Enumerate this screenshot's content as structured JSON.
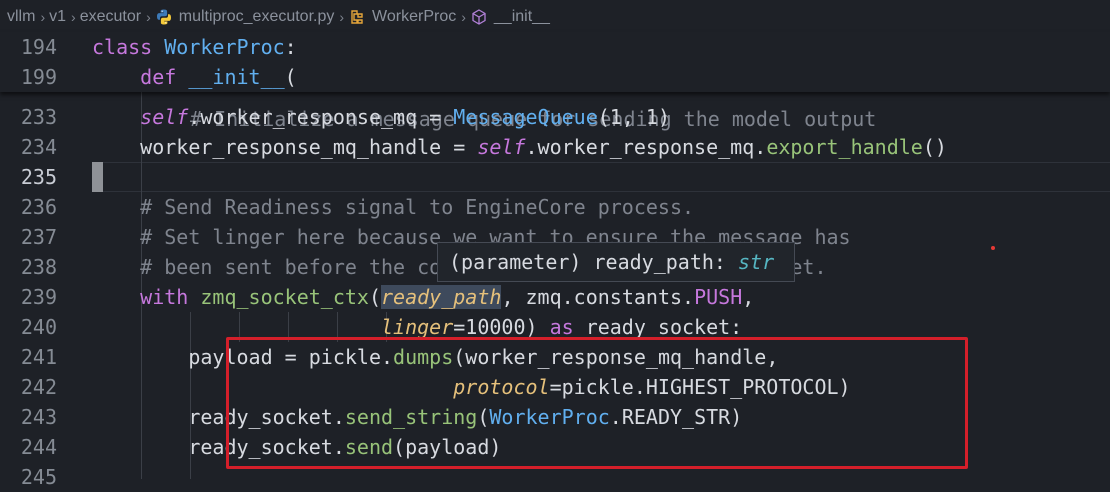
{
  "breadcrumb": {
    "items": [
      "vllm",
      "v1",
      "executor",
      "multiproc_executor.py",
      "WorkerProc",
      "__init__"
    ]
  },
  "sticky": [
    {
      "ln": "194",
      "tokens": [
        [
          "kw",
          "class "
        ],
        [
          "cls",
          "WorkerProc"
        ],
        [
          "plain",
          ":"
        ]
      ]
    },
    {
      "ln": "199",
      "tokens": [
        [
          "plain",
          "    "
        ],
        [
          "kw",
          "def "
        ],
        [
          "cls2",
          "__init__"
        ],
        [
          "plain",
          "("
        ]
      ]
    }
  ],
  "partial_line_text": "# Initialize a message queue for sending the model output",
  "lines": [
    {
      "ln": "233",
      "tokens": [
        [
          "plain",
          "    "
        ],
        [
          "self",
          "self"
        ],
        [
          "plain",
          ".worker_response_mq = "
        ],
        [
          "cls",
          "MessageQueue"
        ],
        [
          "plain",
          "(1, 1)"
        ]
      ]
    },
    {
      "ln": "234",
      "tokens": [
        [
          "plain",
          "    worker_response_mq_handle = "
        ],
        [
          "self",
          "self"
        ],
        [
          "plain",
          ".worker_response_mq."
        ],
        [
          "fn",
          "export_handle"
        ],
        [
          "plain",
          "()"
        ]
      ]
    },
    {
      "ln": "235",
      "tokens": [
        [
          "plain",
          ""
        ]
      ]
    },
    {
      "ln": "236",
      "tokens": [
        [
          "cm",
          "    # Send Readiness signal to EngineCore process."
        ]
      ]
    },
    {
      "ln": "237",
      "tokens": [
        [
          "cm",
          "    # Set linger here because we want to ensure the message has"
        ]
      ]
    },
    {
      "ln": "238",
      "tokens": [
        [
          "cm",
          "    # been sent before the context manager closes the socket."
        ]
      ]
    },
    {
      "ln": "239",
      "tokens": [
        [
          "plain",
          "    "
        ],
        [
          "kw",
          "with "
        ],
        [
          "fn",
          "zmq_socket_ctx"
        ],
        [
          "plain",
          "("
        ],
        [
          "prmhl",
          "ready_path"
        ],
        [
          "plain",
          ", zmq.constants."
        ],
        [
          "const",
          "PUSH"
        ],
        [
          "plain",
          ","
        ]
      ]
    },
    {
      "ln": "240",
      "tokens": [
        [
          "plain",
          "                        "
        ],
        [
          "prm",
          "linger"
        ],
        [
          "plain",
          "=10000) "
        ],
        [
          "kw",
          "as "
        ],
        [
          "plain",
          "ready_socket:"
        ]
      ]
    },
    {
      "ln": "241",
      "tokens": [
        [
          "plain",
          "        payload = pickle."
        ],
        [
          "fn",
          "dumps"
        ],
        [
          "plain",
          "(worker_response_mq_handle,"
        ]
      ]
    },
    {
      "ln": "242",
      "tokens": [
        [
          "plain",
          "                              "
        ],
        [
          "prm",
          "protocol"
        ],
        [
          "plain",
          "=pickle.HIGHEST_PROTOCOL)"
        ]
      ]
    },
    {
      "ln": "243",
      "tokens": [
        [
          "plain",
          "        ready_socket."
        ],
        [
          "fn",
          "send_string"
        ],
        [
          "plain",
          "("
        ],
        [
          "cls",
          "WorkerProc"
        ],
        [
          "plain",
          ".READY_STR)"
        ]
      ]
    },
    {
      "ln": "244",
      "tokens": [
        [
          "plain",
          "        ready_socket."
        ],
        [
          "fn",
          "send"
        ],
        [
          "plain",
          "(payload)"
        ]
      ]
    },
    {
      "ln": "245",
      "tokens": [
        [
          "plain",
          ""
        ]
      ]
    }
  ],
  "hover": {
    "prefix": "(parameter) ready_path: ",
    "type": "str"
  },
  "colors": {
    "background": "#1e2127",
    "keyword": "#c678dd",
    "class": "#61afef",
    "function": "#98c379",
    "comment": "#7f848e",
    "parameter": "#e5c07b",
    "highlight_box": "#d41f2a"
  }
}
